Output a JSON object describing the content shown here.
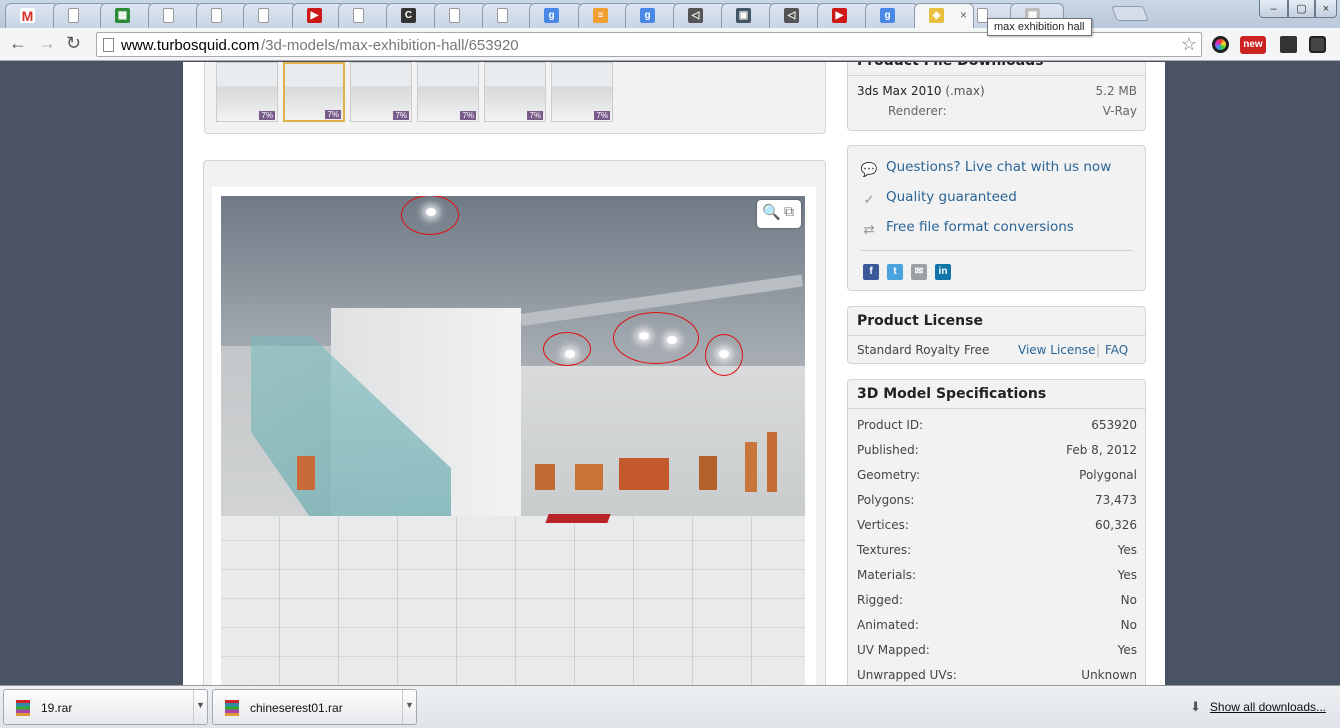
{
  "browser": {
    "tabs": [
      {
        "icon": "gmail-icon",
        "color": "#d93025",
        "glyph": "M"
      },
      {
        "icon": "page-icon",
        "color": "#ffffff",
        "glyph": ""
      },
      {
        "icon": "sheet-icon",
        "color": "#2e8b3a",
        "glyph": "▦"
      },
      {
        "icon": "page-icon",
        "color": "#ffffff",
        "glyph": ""
      },
      {
        "icon": "page-icon",
        "color": "#ffffff",
        "glyph": ""
      },
      {
        "icon": "page-icon",
        "color": "#ffffff",
        "glyph": ""
      },
      {
        "icon": "youtube-icon",
        "color": "#cc1818",
        "glyph": "▶"
      },
      {
        "icon": "page-icon",
        "color": "#ffffff",
        "glyph": ""
      },
      {
        "icon": "c-logo-icon",
        "color": "#333333",
        "glyph": "C"
      },
      {
        "icon": "page-icon",
        "color": "#ffffff",
        "glyph": ""
      },
      {
        "icon": "page-icon",
        "color": "#ffffff",
        "glyph": ""
      },
      {
        "icon": "google-icon",
        "color": "#4a88e8",
        "glyph": "g"
      },
      {
        "icon": "stack-icon",
        "color": "#f0a030",
        "glyph": "≡"
      },
      {
        "icon": "google-icon",
        "color": "#4a88e8",
        "glyph": "g"
      },
      {
        "icon": "unity-icon",
        "color": "#555555",
        "glyph": "◁"
      },
      {
        "icon": "sc-icon",
        "color": "#445566",
        "glyph": "▣"
      },
      {
        "icon": "unity-icon",
        "color": "#555555",
        "glyph": "◁"
      },
      {
        "icon": "youtube-icon",
        "color": "#cc1818",
        "glyph": "▶"
      },
      {
        "icon": "google-icon",
        "color": "#4a88e8",
        "glyph": "g"
      },
      {
        "icon": "turbosquid-icon",
        "color": "#e8c040",
        "glyph": "◈"
      },
      {
        "icon": "page-icon",
        "color": "#ffffff",
        "glyph": ""
      },
      {
        "icon": "grid-icon",
        "color": "#bbbbbb",
        "glyph": "▦"
      }
    ],
    "active_tab_tooltip": "max exhibition hall",
    "close_glyph": "×",
    "url_host": "www.turbosquid.com",
    "url_path": "/3d-models/max-exhibition-hall/653920",
    "extensions": [
      {
        "icon": "color-wheel-icon",
        "color": "#222222"
      },
      {
        "icon": "new-badge-icon",
        "color": "#cc2222"
      },
      {
        "icon": "puzzle-icon",
        "color": "#333333"
      },
      {
        "icon": "menu-icon",
        "color": "#333333"
      }
    ]
  },
  "gallery": {
    "thumbnails": [
      {
        "label": "7%",
        "selected": false
      },
      {
        "label": "7%",
        "selected": true
      },
      {
        "label": "7%",
        "selected": false
      },
      {
        "label": "7%",
        "selected": false
      },
      {
        "label": "7%",
        "selected": false
      },
      {
        "label": "7%",
        "selected": false
      }
    ]
  },
  "downloads": {
    "title": "Product File Downloads",
    "file": "3ds Max 2010",
    "ext": "(.max)",
    "size": "5.2 MB",
    "renderer_label": "Renderer:",
    "renderer": "V-Ray"
  },
  "services": [
    {
      "icon": "chat-bubble-icon",
      "glyph": "💬",
      "label": "Questions? Live chat with us now"
    },
    {
      "icon": "check-badge-icon",
      "glyph": "✓",
      "label": "Quality guaranteed"
    },
    {
      "icon": "convert-arrows-icon",
      "glyph": "⇄",
      "label": "Free file format conversions"
    }
  ],
  "share": [
    {
      "icon": "facebook-icon",
      "color": "#3b5998",
      "glyph": "f"
    },
    {
      "icon": "twitter-icon",
      "color": "#4aa3df",
      "glyph": "t"
    },
    {
      "icon": "email-icon",
      "color": "#9aa0a6",
      "glyph": "✉"
    },
    {
      "icon": "linkedin-icon",
      "color": "#0e76a8",
      "glyph": "in"
    }
  ],
  "license": {
    "title": "Product License",
    "type": "Standard Royalty Free",
    "view": "View License",
    "sep": "|",
    "faq": "FAQ"
  },
  "specs": {
    "title": "3D Model Specifications",
    "rows": [
      {
        "label": "Product ID:",
        "value": "653920"
      },
      {
        "label": "Published:",
        "value": "Feb 8, 2012"
      },
      {
        "label": "Geometry:",
        "value": "Polygonal"
      },
      {
        "label": "Polygons:",
        "value": "73,473"
      },
      {
        "label": "Vertices:",
        "value": "60,326"
      },
      {
        "label": "Textures:",
        "value": "Yes"
      },
      {
        "label": "Materials:",
        "value": "Yes"
      },
      {
        "label": "Rigged:",
        "value": "No"
      },
      {
        "label": "Animated:",
        "value": "No"
      },
      {
        "label": "UV Mapped:",
        "value": "Yes"
      },
      {
        "label": "Unwrapped UVs:",
        "value": "Unknown"
      }
    ]
  },
  "download_bar": {
    "items": [
      {
        "name": "19.rar"
      },
      {
        "name": "chineserest01.rar"
      }
    ],
    "show_all": "Show all downloads..."
  }
}
